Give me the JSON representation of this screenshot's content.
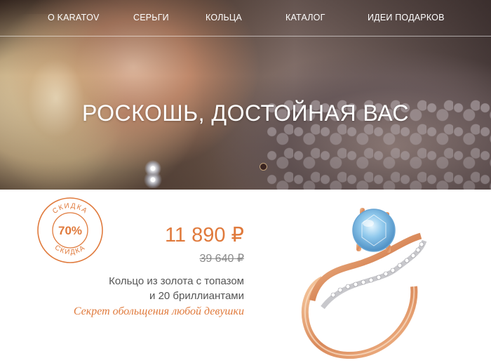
{
  "nav": {
    "items": [
      {
        "label": "О KARATOV"
      },
      {
        "label": "СЕРЬГИ"
      },
      {
        "label": "КОЛЬЦА"
      },
      {
        "label": "КАТАЛОГ"
      },
      {
        "label": "ИДЕИ ПОДАРКОВ"
      }
    ]
  },
  "hero": {
    "title": "РОСКОШЬ, ДОСТОЙНАЯ ВАС"
  },
  "promo": {
    "badge_top": "СКИДКА",
    "badge_bottom": "СКИДКА",
    "discount": "70%",
    "price_new": "11 890 ₽",
    "price_old": "39 640 ₽",
    "description_line1": "Кольцо из золота с топазом",
    "description_line2": "и 20 бриллиантами",
    "slogan": "Секрет обольщения любой девушки"
  },
  "colors": {
    "accent": "#e07a3c",
    "text_gray": "#555555",
    "old_price_gray": "#8a8a8a"
  }
}
